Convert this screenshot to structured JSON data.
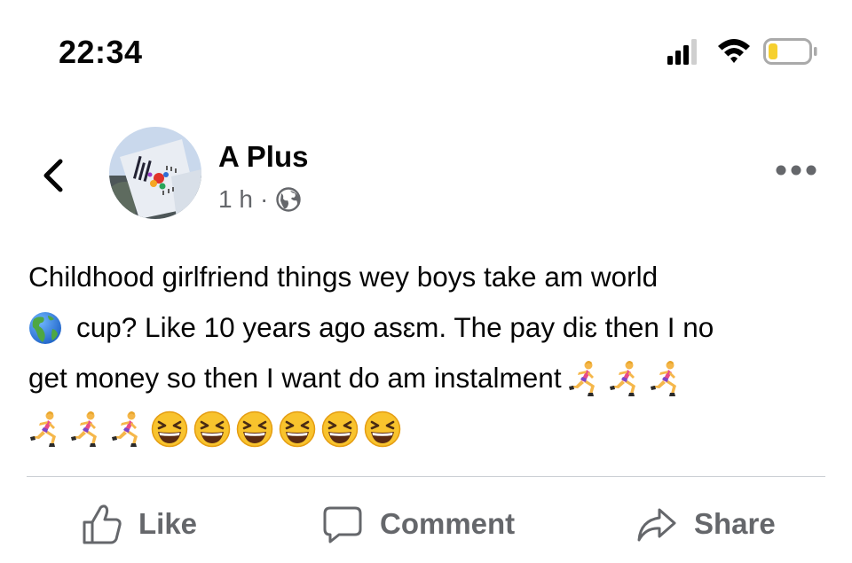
{
  "status_bar": {
    "time": "22:34",
    "battery_level": 0.15,
    "battery_color": "#f6d02f"
  },
  "post": {
    "author": "A Plus",
    "time_ago": "1 h",
    "separator": "·",
    "privacy_icon": "globe-icon",
    "text_lines": [
      "Childhood girlfriend things wey boys take am world",
      "cup? Like 10 years ago asɛm. The pay diɛ then I no",
      "get money so then I want do am instalment"
    ],
    "emojis": {
      "globe": "earth-americas-emoji",
      "runner": "running-person-emoji",
      "runner_count": 6,
      "laughing": "grinning-squinting-face-emoji",
      "laughing_count": 6
    }
  },
  "actions": {
    "like": "Like",
    "comment": "Comment",
    "share": "Share"
  },
  "colors": {
    "text": "#050505",
    "secondary": "#65676b",
    "divider": "#ccd0d5"
  }
}
